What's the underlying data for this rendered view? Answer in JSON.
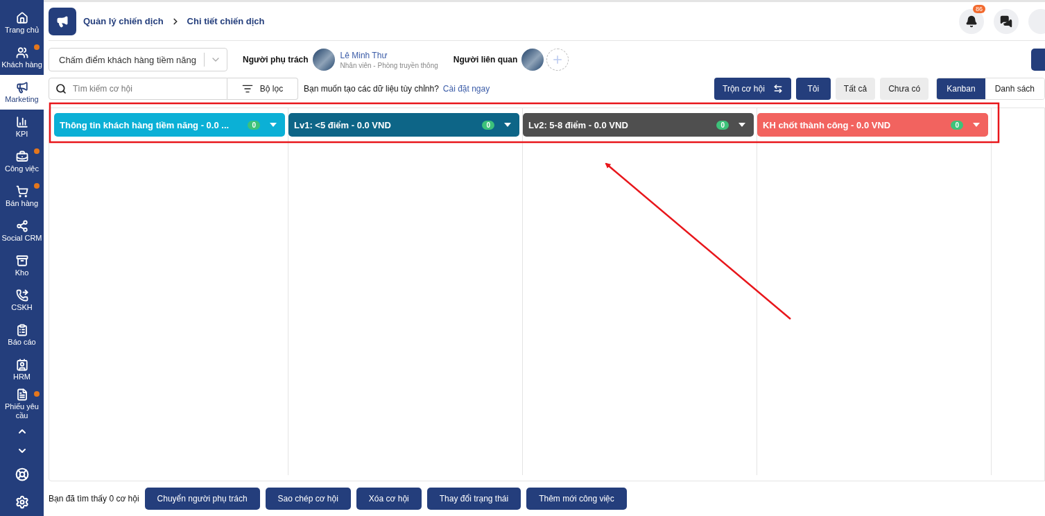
{
  "sidebar": {
    "items": [
      {
        "label": "Trang chủ",
        "selected": false,
        "notify": false
      },
      {
        "label": "Khách hàng",
        "selected": false,
        "notify": true
      },
      {
        "label": "Marketing",
        "selected": true,
        "notify": false
      },
      {
        "label": "KPI",
        "selected": false,
        "notify": false
      },
      {
        "label": "Công việc",
        "selected": false,
        "notify": true
      },
      {
        "label": "Bán hàng",
        "selected": false,
        "notify": true
      },
      {
        "label": "Social CRM",
        "selected": false,
        "notify": false
      },
      {
        "label": "Kho",
        "selected": false,
        "notify": false
      },
      {
        "label": "CSKH",
        "selected": false,
        "notify": false
      },
      {
        "label": "Báo cáo",
        "selected": false,
        "notify": false
      },
      {
        "label": "HRM",
        "selected": false,
        "notify": false
      },
      {
        "label": "Phiếu yêu cầu",
        "selected": false,
        "notify": true
      }
    ]
  },
  "breadcrumb": [
    "Quản lý chiến dịch",
    "Chi tiết chiến dịch"
  ],
  "notifications": {
    "count": "86"
  },
  "campaign_select": {
    "value": "Chấm điểm khách hàng tiềm năng"
  },
  "owner": {
    "label": "Người phụ trách",
    "name": "Lê Minh Thư",
    "role": "Nhân viên - Phòng truyền thông"
  },
  "related": {
    "label": "Người liên quan"
  },
  "search": {
    "placeholder": "Tìm kiếm cơ hội"
  },
  "filter_button": "Bộ lọc",
  "custom_prompt": {
    "text": "Bạn muốn tạo các dữ liệu tùy chỉnh?",
    "link": "Cài đặt ngay"
  },
  "merge_button": "Trộn cơ hội",
  "owner_filters": [
    {
      "label": "Tôi",
      "selected": true
    },
    {
      "label": "Tất cả",
      "selected": false
    },
    {
      "label": "Chưa có",
      "selected": false
    }
  ],
  "views": [
    {
      "label": "Kanban",
      "selected": true
    },
    {
      "label": "Danh sách",
      "selected": false
    }
  ],
  "columns": [
    {
      "title": "Thông tin khách hàng tiềm năng - 0.0 ...",
      "count": "0",
      "color": "#0bb0d6"
    },
    {
      "title": "Lv1: <5 điểm - 0.0 VND",
      "count": "0",
      "color": "#0d6587"
    },
    {
      "title": "Lv2: 5-8 điểm - 0.0 VND",
      "count": "0",
      "color": "#4f4f4f"
    },
    {
      "title": "KH chốt thành công - 0.0 VND",
      "count": "0",
      "color": "#f2635f"
    }
  ],
  "footer": {
    "result": "Bạn đã tìm thấy 0 cơ hội",
    "actions": [
      "Chuyển người phụ trách",
      "Sao chép cơ hội",
      "Xóa cơ hội",
      "Thay đổi trạng thái",
      "Thêm mới công việc"
    ]
  }
}
